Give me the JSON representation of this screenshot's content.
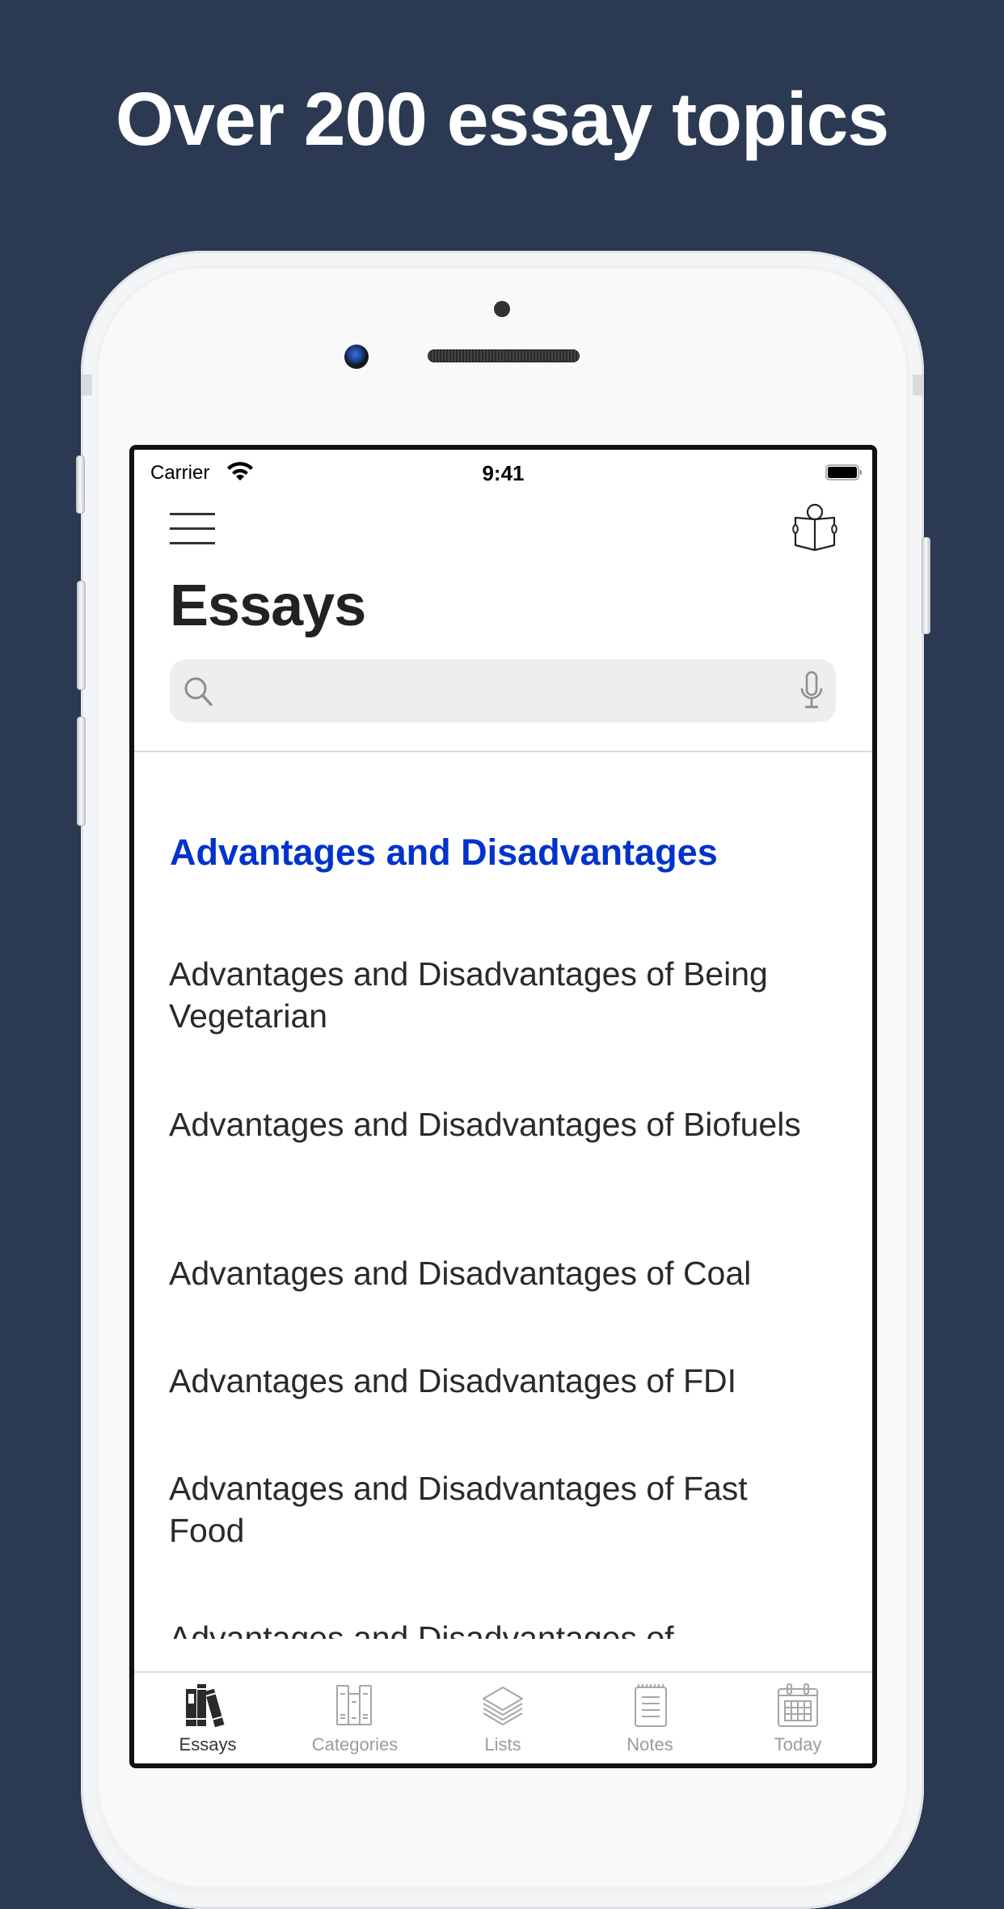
{
  "headline": "Over 200 essay topics",
  "colors": {
    "background": "#2b3a52",
    "accent": "#0033cc",
    "text": "#2a2a2a",
    "tab_inactive": "#9b9b9b",
    "tab_active": "#333333"
  },
  "status_bar": {
    "carrier": "Carrier",
    "time": "9:41",
    "wifi_icon": "wifi-icon",
    "battery_icon": "battery-icon"
  },
  "nav": {
    "menu_icon": "hamburger-menu-icon",
    "reader_icon": "person-reading-icon"
  },
  "page_title": "Essays",
  "search": {
    "value": "",
    "placeholder": "",
    "search_icon": "magnifier-icon",
    "mic_icon": "microphone-icon"
  },
  "list": {
    "section_header": "Advantages and Disadvantages",
    "items": [
      {
        "title": "Advantages and Disadvantages of Being Vegetarian"
      },
      {
        "title": "Advantages and Disadvantages of Biofuels"
      },
      {
        "title": "Advantages and Disadvantages of Coal"
      },
      {
        "title": "Advantages and Disadvantages of FDI"
      },
      {
        "title": "Advantages and Disadvantages of Fast Food"
      },
      {
        "title": "Advantages and Disadvantages of Globalization"
      }
    ]
  },
  "tabs": [
    {
      "label": "Essays",
      "icon": "books-icon",
      "active": true
    },
    {
      "label": "Categories",
      "icon": "bookshelf-icon",
      "active": false
    },
    {
      "label": "Lists",
      "icon": "layers-icon",
      "active": false
    },
    {
      "label": "Notes",
      "icon": "notepad-icon",
      "active": false
    },
    {
      "label": "Today",
      "icon": "calendar-icon",
      "active": false
    }
  ]
}
